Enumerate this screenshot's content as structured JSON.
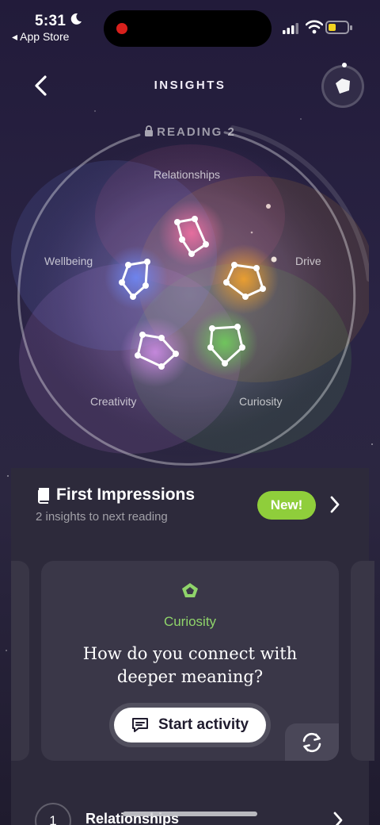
{
  "status_bar": {
    "time": "5:31",
    "back_app": "◂ App Store",
    "battery_level": 0.25
  },
  "header": {
    "title": "INSIGHTS"
  },
  "wheel": {
    "reading_label": "READING 2",
    "areas": {
      "relationships": "Relationships",
      "drive": "Drive",
      "curiosity": "Curiosity",
      "creativity": "Creativity",
      "wellbeing": "Wellbeing"
    },
    "colors": {
      "relationships": "#ec6fa0",
      "drive": "#f0a12e",
      "curiosity": "#6fcf5a",
      "creativity": "#c98ae0",
      "wellbeing": "#6f86f2"
    }
  },
  "impressions": {
    "title": "First Impressions",
    "subtitle": "2 insights to next reading",
    "badge": "New!"
  },
  "activity_card": {
    "category": "Curiosity",
    "question": "How do you connect with deeper meaning?",
    "start_label": "Start activity",
    "accent": "#8fd46a"
  },
  "list": {
    "items": [
      {
        "number": "1",
        "label": "Relationships"
      }
    ]
  }
}
